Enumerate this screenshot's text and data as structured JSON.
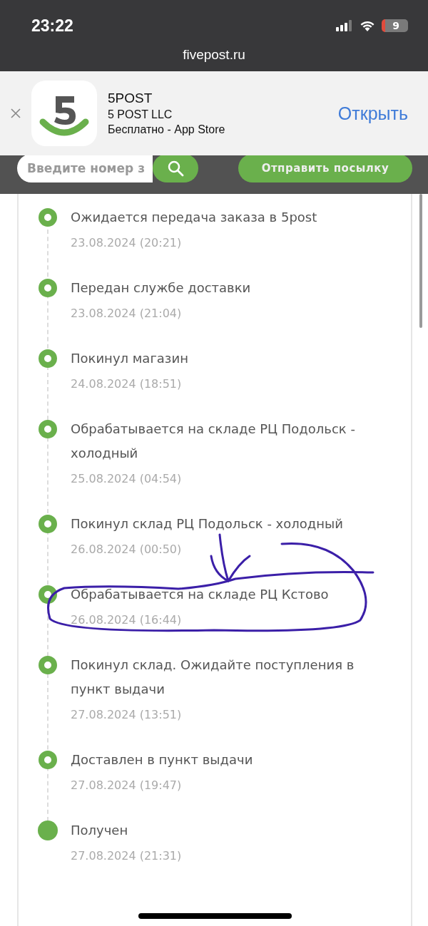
{
  "status_bar": {
    "time": "23:22",
    "battery": "9"
  },
  "address_bar": {
    "url": "fivepost.ru"
  },
  "app_banner": {
    "name": "5POST",
    "developer": "5 POST LLC",
    "price": "Бесплатно - App Store",
    "open_label": "Открыть"
  },
  "tracking": {
    "search": {
      "placeholder": "Введите номер з"
    },
    "send_button": "Отправить посылку"
  },
  "timeline": [
    {
      "title": "Ожидается передача заказа в 5post",
      "date": "23.08.2024 (20:21)",
      "current": false
    },
    {
      "title": "Передан службе доставки",
      "date": "23.08.2024 (21:04)",
      "current": false
    },
    {
      "title": "Покинул магазин",
      "date": "24.08.2024 (18:51)",
      "current": false
    },
    {
      "title": "Обрабатывается на складе РЦ Подольск - холодный",
      "date": "25.08.2024 (04:54)",
      "current": false
    },
    {
      "title": "Покинул склад РЦ Подольск - холодный",
      "date": "26.08.2024 (00:50)",
      "current": false
    },
    {
      "title": "Обрабатывается на складе РЦ Кстово",
      "date": "26.08.2024 (16:44)",
      "current": false
    },
    {
      "title": "Покинул склад. Ожидайте поступления в пункт выдачи",
      "date": "27.08.2024 (13:51)",
      "current": false
    },
    {
      "title": "Доставлен в пункт выдачи",
      "date": "27.08.2024 (19:47)",
      "current": false
    },
    {
      "title": "Получен",
      "date": "27.08.2024 (21:31)",
      "current": true
    }
  ]
}
